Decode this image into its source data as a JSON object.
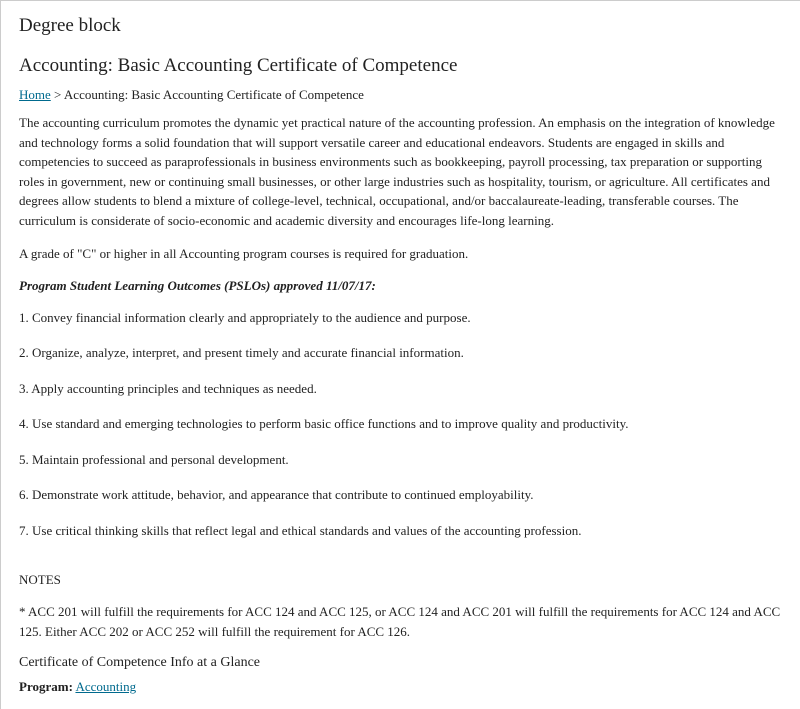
{
  "section_title": "Degree block",
  "page_title": "Accounting: Basic Accounting Certificate of Competence",
  "breadcrumb": {
    "home_label": "Home",
    "separator": ">",
    "current": "Accounting: Basic Accounting Certificate of Competence"
  },
  "intro_paragraph": "The accounting curriculum promotes the dynamic yet practical nature of the accounting profession. An emphasis on the integration of knowledge and technology forms a solid foundation that will support versatile career and educational endeavors. Students are engaged in skills and competencies to succeed as paraprofessionals in business environments such as bookkeeping, payroll processing, tax preparation or supporting roles in government, new or continuing small businesses, or other large industries such as hospitality, tourism, or agriculture. All certificates and degrees allow students to blend a mixture of college-level, technical, occupational, and/or baccalaureate-leading, transferable courses. The curriculum is considerate of socio-economic and academic diversity and encourages life-long learning.",
  "grade_requirement": "A grade of \"C\" or higher in all Accounting program courses is required for graduation.",
  "pslo_heading": "Program Student Learning Outcomes (PSLOs) approved 11/07/17:",
  "pslos": [
    "1. Convey financial information clearly and appropriately to the audience and purpose.",
    "2. Organize, analyze, interpret, and present timely and accurate financial information.",
    "3. Apply accounting principles and techniques as needed.",
    "4. Use standard and emerging technologies to perform basic office functions and to improve quality and productivity.",
    "5. Maintain professional and personal development.",
    "6. Demonstrate work attitude, behavior, and appearance that contribute to continued employability.",
    "7. Use critical thinking skills that reflect legal and ethical standards and values of the accounting profession."
  ],
  "notes_heading": "NOTES",
  "notes_text": "* ACC 201 will fulfill the requirements for ACC 124 and ACC 125, or ACC 124 and ACC 201 will fulfill the requirements for ACC 124 and ACC 125. Either ACC 202 or ACC 252 will fulfill the requirement for ACC 126.",
  "glance_title": "Certificate of Competence Info at a Glance",
  "program_label": "Program:",
  "program_link_text": "Accounting"
}
